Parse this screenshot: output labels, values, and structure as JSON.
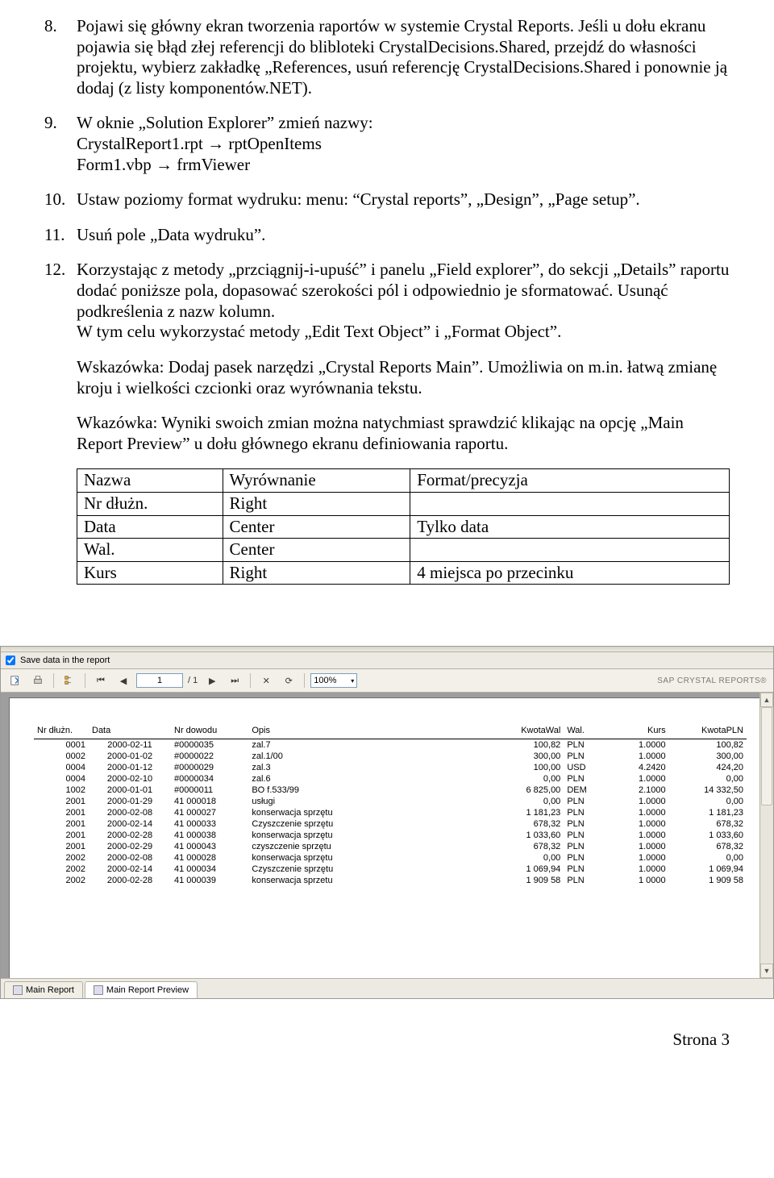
{
  "items": [
    {
      "num": "8.",
      "text": "Pojawi się główny ekran tworzenia raportów w systemie Crystal Reports. Jeśli u dołu ekranu pojawia się błąd złej referencji do blibloteki CrystalDecisions.Shared, przejdź do własności projektu, wybierz zakładkę „References, usuń referencję CrystalDecisions.Shared i ponownie ją dodaj (z listy komponentów.NET)."
    },
    {
      "num": "9.",
      "text": "W oknie „Solution Explorer” zmień nazwy:\nCrystalReport1.rpt → rptOpenItems\nForm1.vbp → frmViewer"
    },
    {
      "num": "10.",
      "text": "Ustaw poziomy format wydruku: menu: “Crystal reports”, „Design”, „Page setup”."
    },
    {
      "num": "11.",
      "text": "Usuń pole „Data wydruku”."
    },
    {
      "num": "12.",
      "text": "Korzystając z metody „przciągnij-i-upuść” i panelu „Field explorer”, do sekcji „Details” raportu dodać poniższe pola, dopasować szerokości pól i odpowiednio je sformatować. Usunąć podkreślenia z nazw kolumn.\nW tym celu wykorzystać metody „Edit Text Object” i „Format Object”."
    }
  ],
  "tips": [
    "Wskazówka: Dodaj pasek narzędzi „Crystal Reports Main”. Umożliwia on m.in. łatwą zmianę kroju i wielkości czcionki oraz wyrównania tekstu.",
    "Wkazówka: Wyniki swoich zmian można natychmiast sprawdzić klikając na opcję „Main Report Preview” u dołu głównego ekranu definiowania raportu."
  ],
  "design_table": {
    "headers": [
      "Nazwa",
      "Wyrównanie",
      "Format/precyzja"
    ],
    "rows": [
      [
        "Nr dłużn.",
        "Right",
        ""
      ],
      [
        "Data",
        "Center",
        "Tylko data"
      ],
      [
        "Wal.",
        "Center",
        ""
      ],
      [
        "Kurs",
        "Right",
        "4 miejsca po przecinku"
      ]
    ]
  },
  "toolbar": {
    "save_label": "Save data in the report",
    "page_value": "1",
    "page_total": "/ 1",
    "zoom": "100%",
    "brand": "SAP CRYSTAL REPORTS®"
  },
  "report": {
    "headers": [
      "Nr dłużn.",
      "Data",
      "Nr dowodu",
      "Opis",
      "KwotaWal",
      "Wal.",
      "Kurs",
      "KwotaPLN"
    ],
    "rows": [
      [
        "0001",
        "2000-02-11",
        "#0000035",
        "zal.7",
        "100,82",
        "PLN",
        "1.0000",
        "100,82"
      ],
      [
        "0002",
        "2000-01-02",
        "#0000022",
        "zal.1/00",
        "300,00",
        "PLN",
        "1.0000",
        "300,00"
      ],
      [
        "0004",
        "2000-01-12",
        "#0000029",
        "zal.3",
        "100,00",
        "USD",
        "4.2420",
        "424,20"
      ],
      [
        "0004",
        "2000-02-10",
        "#0000034",
        "zal.6",
        "0,00",
        "PLN",
        "1.0000",
        "0,00"
      ],
      [
        "1002",
        "2000-01-01",
        "#0000011",
        "BO f.533/99",
        "6 825,00",
        "DEM",
        "2.1000",
        "14 332,50"
      ],
      [
        "2001",
        "2000-01-29",
        "41 000018",
        "usługi",
        "0,00",
        "PLN",
        "1.0000",
        "0,00"
      ],
      [
        "2001",
        "2000-02-08",
        "41 000027",
        "konserwacja sprzętu",
        "1 181,23",
        "PLN",
        "1.0000",
        "1 181,23"
      ],
      [
        "2001",
        "2000-02-14",
        "41 000033",
        "Czyszczenie sprzętu",
        "678,32",
        "PLN",
        "1.0000",
        "678,32"
      ],
      [
        "2001",
        "2000-02-28",
        "41 000038",
        "konserwacja sprzętu",
        "1 033,60",
        "PLN",
        "1.0000",
        "1 033,60"
      ],
      [
        "2001",
        "2000-02-29",
        "41 000043",
        "czyszczenie sprzętu",
        "678,32",
        "PLN",
        "1.0000",
        "678,32"
      ],
      [
        "2002",
        "2000-02-08",
        "41 000028",
        "konserwacja sprzętu",
        "0,00",
        "PLN",
        "1.0000",
        "0,00"
      ],
      [
        "2002",
        "2000-02-14",
        "41 000034",
        "Czyszczenie sprzętu",
        "1 069,94",
        "PLN",
        "1.0000",
        "1 069,94"
      ],
      [
        "2002",
        "2000-02-28",
        "41 000039",
        "konserwacja sprzetu",
        "1 909 58",
        "PLN",
        "1 0000",
        "1 909 58"
      ]
    ]
  },
  "tabs": {
    "main": "Main Report",
    "preview": "Main Report Preview"
  },
  "footer": "Strona 3"
}
